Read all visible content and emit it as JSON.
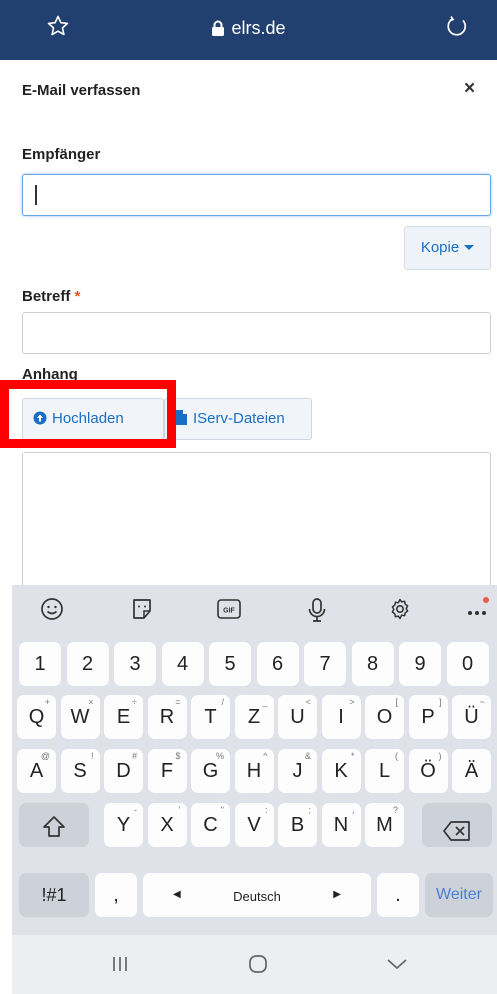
{
  "browser": {
    "url": "elrs.de"
  },
  "dialog": {
    "title": "E-Mail verfassen",
    "close": "×",
    "recipient_label": "Empfänger",
    "copy_button": "Kopie",
    "subject_label": "Betreff",
    "required_mark": "*",
    "attachment_label": "Anhang",
    "upload_button": "Hochladen",
    "iserv_button": "IServ-Dateien"
  },
  "keyboard": {
    "numbers": [
      "1",
      "2",
      "3",
      "4",
      "5",
      "6",
      "7",
      "8",
      "9",
      "0"
    ],
    "row1": [
      "Q",
      "W",
      "E",
      "R",
      "T",
      "Z",
      "U",
      "I",
      "O",
      "P",
      "Ü"
    ],
    "row1_hints": [
      "+",
      "×",
      "÷",
      "=",
      "/",
      "_",
      "<",
      ">",
      "[",
      "]",
      "~"
    ],
    "row2": [
      "A",
      "S",
      "D",
      "F",
      "G",
      "H",
      "J",
      "K",
      "L",
      "Ö",
      "Ä"
    ],
    "row2_hints": [
      "@",
      "!",
      "#",
      "$",
      "%",
      "^",
      "&",
      "*",
      "(",
      ")",
      ""
    ],
    "row3": [
      "Y",
      "X",
      "C",
      "V",
      "B",
      "N",
      "M"
    ],
    "row3_hints": [
      "-",
      "'",
      "\"",
      ":",
      ";",
      ",",
      "?"
    ],
    "symbols_key": "!#1",
    "comma_key": ",",
    "space_label": "Deutsch",
    "period_key": ".",
    "enter_label": "Weiter"
  },
  "colors": {
    "browser_bar": "#22406f",
    "link_blue": "#1b6fc2",
    "highlight_red": "#ff0000",
    "keyboard_bg": "#dfe2e8"
  }
}
